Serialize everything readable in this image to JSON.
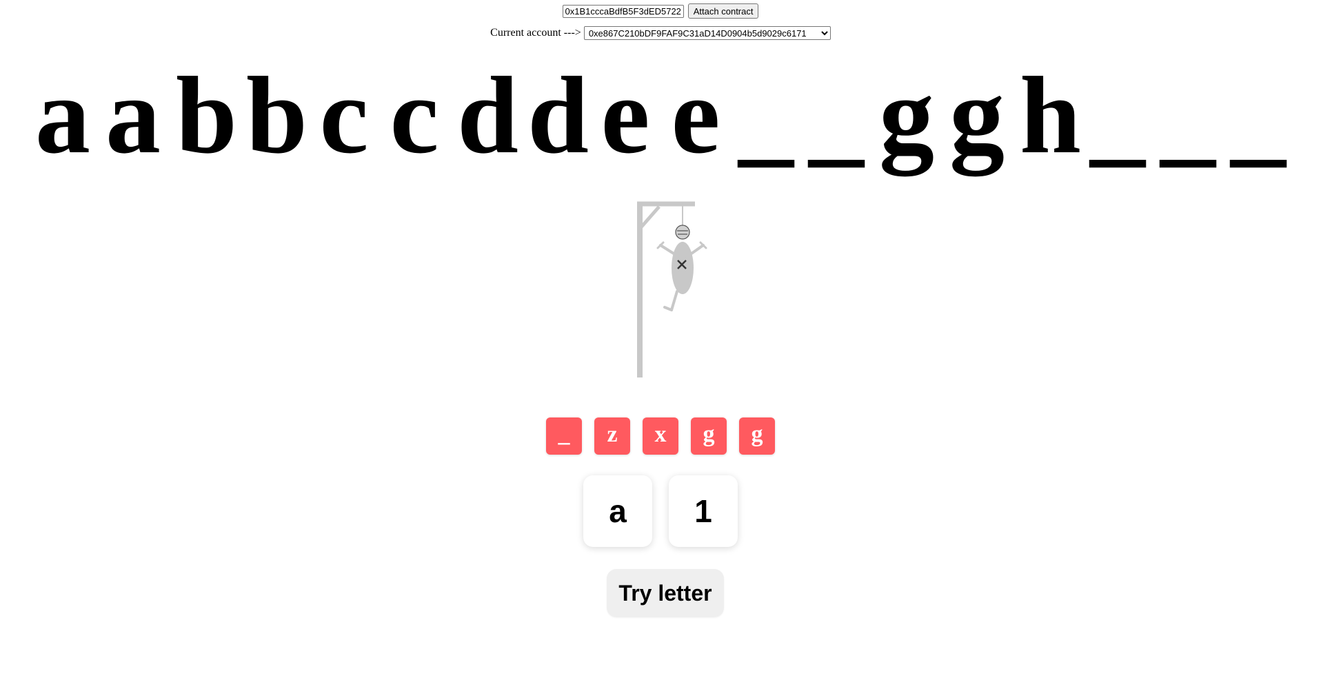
{
  "contract": {
    "address_value": "0x1B1cccaBdfB5F3dED5722",
    "attach_label": "Attach contract"
  },
  "account": {
    "label": "Current account --->",
    "selected": "0xe867C210bDF9FAF9C31aD14D0904b5d9029c6171"
  },
  "word": {
    "letters": [
      "a",
      "a",
      "b",
      "b",
      "c",
      "c",
      "d",
      "d",
      "e",
      "e",
      "_",
      "_",
      "g",
      "g",
      "h",
      "_",
      "_",
      "_"
    ]
  },
  "hangman": {
    "gallows_color": "#c8c8c8",
    "figure_color": "#c8c8c8"
  },
  "wrong_letters": [
    "_",
    "z",
    "x",
    "g",
    "g"
  ],
  "guess": {
    "letter_value": "a",
    "number_value": "1"
  },
  "try_button": {
    "label": "Try letter"
  },
  "colors": {
    "wrong_tile": "#ff5a5f",
    "button_bg": "#efefef"
  }
}
